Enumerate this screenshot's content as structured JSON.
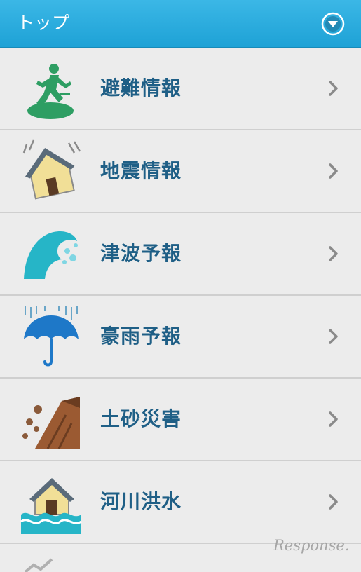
{
  "header": {
    "title": "トップ",
    "menu_icon": "chevron-down-circle-icon"
  },
  "menu": {
    "items": [
      {
        "label": "避難情報",
        "icon": "evacuation-runner-icon"
      },
      {
        "label": "地震情報",
        "icon": "earthquake-house-icon"
      },
      {
        "label": "津波予報",
        "icon": "tsunami-wave-icon"
      },
      {
        "label": "豪雨予報",
        "icon": "rain-umbrella-icon"
      },
      {
        "label": "土砂災害",
        "icon": "landslide-icon"
      },
      {
        "label": "河川洪水",
        "icon": "flood-house-icon"
      }
    ]
  },
  "watermark": "Response.",
  "colors": {
    "header": "#1ea2d6",
    "label": "#1f5f86",
    "background": "#ececec",
    "chevron": "#8a8a8a"
  }
}
